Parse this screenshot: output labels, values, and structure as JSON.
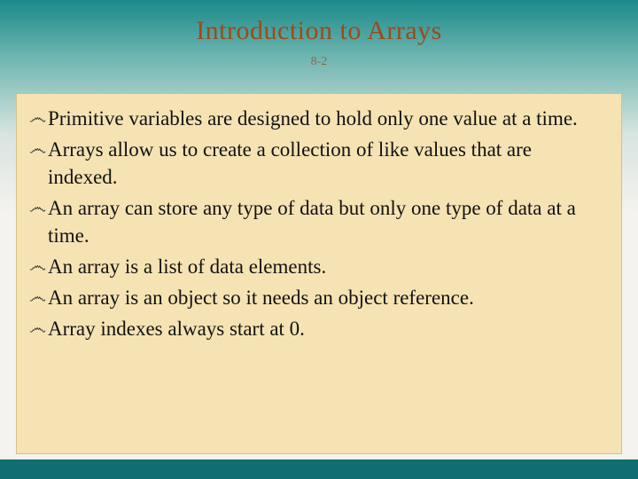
{
  "title": "Introduction to Arrays",
  "page_number": "8-2",
  "bullets": [
    "Primitive variables are designed to hold only one value at a time.",
    "Arrays allow us to create a collection of like values that are indexed.",
    "An array can store any type of data but only one type of data at a time.",
    "An array is a list of data elements.",
    "An array is an object so it needs an object reference.",
    "Array indexes always start at 0."
  ],
  "bullet_marker": "෴"
}
